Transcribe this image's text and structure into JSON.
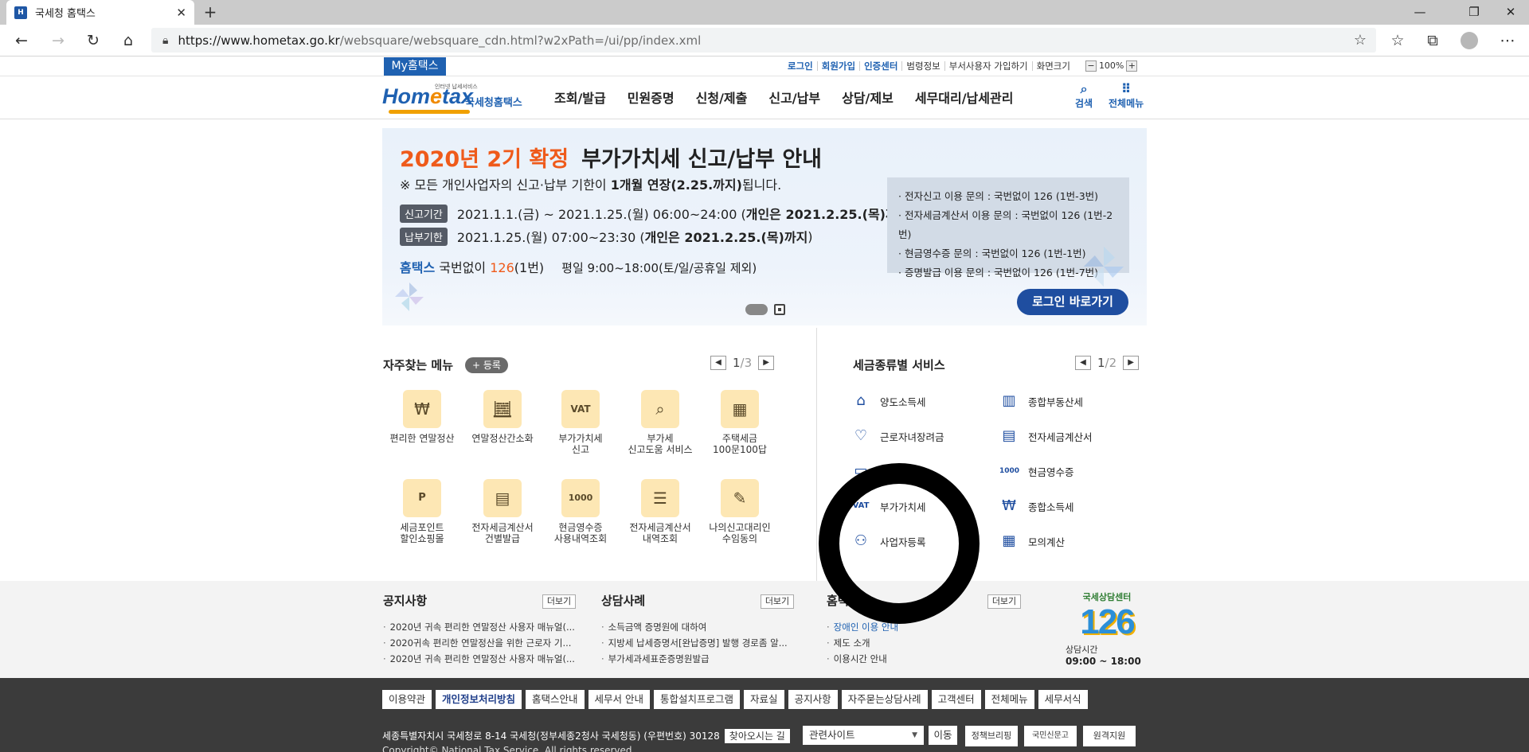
{
  "browser": {
    "tab_title": "국세청 홈택스",
    "favicon_text": "H",
    "url_main": "https://www.hometax.go.kr",
    "url_path": "/websquare/websquare_cdn.html?w2xPath=/ui/pp/index.xml"
  },
  "topbar": {
    "my": "My홈택스",
    "links_blue": [
      "로그인",
      "회원가입",
      "인증센터"
    ],
    "links": [
      "범령정보",
      "부서사용자 가입하기",
      "화면크기"
    ],
    "zoom_minus": "−",
    "zoom": "100%",
    "zoom_plus": "+"
  },
  "header": {
    "logo_text_a": "Hom",
    "logo_text_e": "e",
    "logo_text_b": "tax",
    "logo_tagline": "인터넷 납세서비스",
    "logo_sub": "국세청홈택스",
    "gnb": [
      "조회/발급",
      "민원증명",
      "신청/제출",
      "신고/납부",
      "상담/제보",
      "세무대리/납세관리"
    ],
    "search_label": "검색",
    "allmenu_label": "전체메뉴"
  },
  "banner": {
    "title_orange": "2020년 2기 확정",
    "title_rest": "부가가치세 신고/납부 안내",
    "note_pre": "※ 모든 개인사업자의 신고·납부 기한이 ",
    "note_bold": "1개월 연장(2.25.까지)",
    "note_post": "됩니다.",
    "row1_label": "신고기간",
    "row1_text": "2021.1.1.(금) ~ 2021.1.25.(월) 06:00~24:00 (",
    "row1_bold": "개인은 2021.2.25.(목)까지",
    "row1_end": ")",
    "row2_label": "납부기한",
    "row2_text": "2021.1.25.(월) 07:00~23:30 (",
    "row2_bold": "개인은 2021.2.25.(목)까지",
    "row2_end": ")",
    "call_blue": "홈택스",
    "call_text": " 국번없이 ",
    "call_num": "126",
    "call_suffix": "(1번)",
    "hours": "평일 9:00~18:00(토/일/공휴일 제외)",
    "info": [
      "· 전자신고 이용 문의 : 국번없이 126 (1번-3번)",
      "· 전자세금계산서 이용 문의 : 국번없이 126 (1번-2번)",
      "· 현금영수증 문의 : 국번없이 126 (1번-1번)",
      "· 증명발급 이용 문의 : 국번없이 126 (1번-7번)"
    ],
    "login_button": "로그인 바로가기"
  },
  "favorites": {
    "title": "자주찾는 메뉴",
    "register": "+ 등록",
    "page": "1",
    "total": "/3",
    "items": [
      {
        "label": "편리한 연말정산",
        "icon": "cash-w-icon"
      },
      {
        "label": "연말정산간소화",
        "icon": "calculator-bowl-icon"
      },
      {
        "label": "부가가치세\n신고",
        "icon": "vat-document-icon"
      },
      {
        "label": "부가세\n신고도움 서비스",
        "icon": "magnifier-document-icon"
      },
      {
        "label": "주택세금\n100문100답",
        "icon": "building-icon"
      },
      {
        "label": "세금포인트\n할인쇼핑몰",
        "icon": "shopping-bag-icon"
      },
      {
        "label": "전자세금계산서\n건별발급",
        "icon": "calculator-icon"
      },
      {
        "label": "현금영수증\n사용내역조회",
        "icon": "receipt-magnifier-icon"
      },
      {
        "label": "전자세금계산서\n내역조회",
        "icon": "document-search-icon"
      },
      {
        "label": "나의신고대리인\n수임동의",
        "icon": "handshake-document-icon"
      }
    ]
  },
  "taxservice": {
    "title": "세금종류별 서비스",
    "page": "1",
    "total": "/2",
    "left": [
      "양도소득세",
      "근로자녀장려금",
      "",
      "부가가치세",
      "사업자등록"
    ],
    "right": [
      "종합부동산세",
      "전자세금계산서",
      "현금영수증",
      "종합소득세",
      "모의계산"
    ]
  },
  "board": {
    "notice_title": "공지사항",
    "notice_items": [
      "2020년 귀속 편리한 연말정산 사용자 매뉴얼(...",
      "2020귀속 편리한 연말정산을 위한 근로자 기...",
      "2020년 귀속 편리한 연말정산 사용자 매뉴얼(..."
    ],
    "case_title": "상담사례",
    "case_items": [
      "소득금액 증명원에 대하여",
      "지방세 납세증명서[완납증명] 발행 경로좀 알...",
      "부가세과세표준증명원발급"
    ],
    "third_title": "홈택스",
    "third_items": [
      "장애인 이용 안내",
      "제도 소개",
      "이용시간 안내"
    ],
    "more": "더보기",
    "center_title": "국세상담센터",
    "center_num": "126",
    "center_hours_label": "상담시간",
    "center_hours": "09:00 ~ 18:00"
  },
  "footer": {
    "links": [
      "이용약관",
      "개인정보처리방침",
      "홈택스안내",
      "세무서 안내",
      "통합설치프로그램",
      "자료실",
      "공지사항",
      "자주묻는상담사례",
      "고객센터",
      "전체메뉴",
      "세무서식"
    ],
    "address": "세종특별자치시 국세청로 8-14 국세청(정부세종2청사 국세청동) (우편번호) 30128",
    "directions": "찾아오시는 길",
    "copyright": "Copyright© National Tax Service. All rights reserved.",
    "related": "관련사이트",
    "go": "이동",
    "badges": [
      "정책브리핑",
      "국민신문고",
      "원격지원"
    ]
  }
}
